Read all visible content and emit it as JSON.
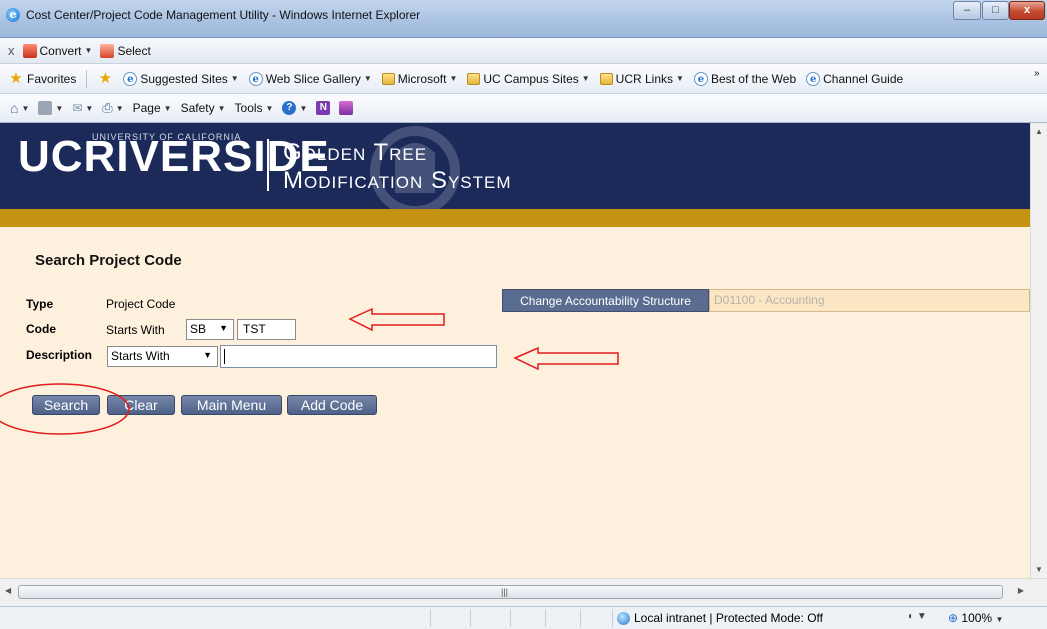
{
  "window": {
    "title": "Cost Center/Project Code Management Utility - Windows Internet Explorer",
    "min_glyph": "–",
    "max_glyph": "□",
    "close_glyph": "x"
  },
  "command_bar": {
    "close_glyph": "x",
    "convert_label": "Convert",
    "select_label": "Select"
  },
  "favorites_bar": {
    "favorites_label": "Favorites",
    "links": [
      {
        "label": "Suggested Sites",
        "icon": "e-icon",
        "dropdown": true
      },
      {
        "label": "Web Slice Gallery",
        "icon": "e-icon",
        "dropdown": true
      },
      {
        "label": "Microsoft",
        "icon": "folder-icon",
        "dropdown": true
      },
      {
        "label": "UC Campus Sites",
        "icon": "folder-icon",
        "dropdown": true
      },
      {
        "label": "UCR Links",
        "icon": "folder-icon",
        "dropdown": true
      },
      {
        "label": "Best of the Web",
        "icon": "e-icon",
        "dropdown": false
      },
      {
        "label": "Channel Guide",
        "icon": "e-icon",
        "dropdown": false
      }
    ],
    "overflow": "»"
  },
  "toolbar": {
    "page_label": "Page",
    "safety_label": "Safety",
    "tools_label": "Tools"
  },
  "banner": {
    "logo_text": "UCRIVERSIDE",
    "uc_tagline": "UNIVERSITY OF CALIFORNIA",
    "system_line1": "Golden Tree",
    "system_line2": "Modification System"
  },
  "form": {
    "title": "Search Project Code",
    "type_label": "Type",
    "type_value": "Project Code",
    "code_label": "Code",
    "code_operator_text": "Starts With",
    "code_select_value": "SB",
    "code_input_value": "TST",
    "description_label": "Description",
    "description_select_value": "Starts With",
    "description_input_value": "",
    "change_button": "Change Accountability Structure",
    "accountability_value": "D01100 - Accounting"
  },
  "actions": {
    "search": "Search",
    "clear": "Clear",
    "main_menu": "Main Menu",
    "add_code": "Add Code"
  },
  "status": {
    "zone_text": "Local intranet | Protected Mode: Off",
    "zoom": "100%"
  },
  "colors": {
    "banner_navy": "#1c2a5a",
    "gold": "#c69214",
    "content_bg": "#fdf0dd",
    "button_slate": "#5a6d91",
    "annotation_red": "#e31b1b"
  }
}
